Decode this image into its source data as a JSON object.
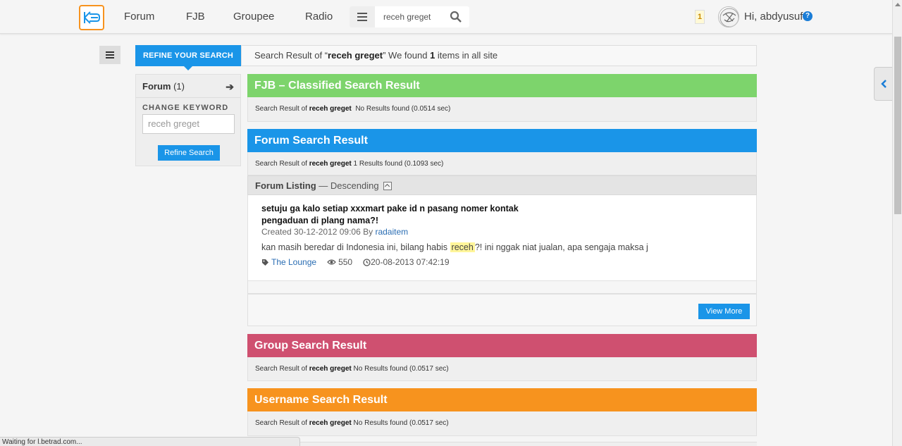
{
  "nav": {
    "links": [
      "Forum",
      "FJB",
      "Groupee",
      "Radio"
    ],
    "search_value": "receh greget",
    "notif_count": "1",
    "greeting": "Hi, abdyusuf",
    "help": "?"
  },
  "refine": {
    "tab_label": "REFINE YOUR SEARCH",
    "summary_prefix": "Search Result of “",
    "summary_query": "receh greget",
    "summary_mid": "” We found ",
    "summary_count": "1",
    "summary_suffix": " items in all site"
  },
  "sidebar": {
    "forum_label": "Forum",
    "forum_count": "(1)",
    "arrow": "➔",
    "change_keyword": "CHANGE KEYWORD",
    "keyword_placeholder": "receh greget",
    "refine_button": "Refine Search"
  },
  "sections": {
    "fjb": {
      "title": "FJB – Classified Search Result",
      "color": "#7dd46c",
      "prefix": "Search Result of ",
      "query": "receh greget",
      "status": "No Results found (0.0514 sec)"
    },
    "forum": {
      "title": "Forum Search Result",
      "color": "#1a95e8",
      "prefix": "Search Result of ",
      "query": "receh greget",
      "status": "1 Results found (0.1093 sec)"
    },
    "group": {
      "title": "Group Search Result",
      "color": "#cf5070",
      "prefix": "Search Result of ",
      "query": "receh greget",
      "status": "No Results found (0.0517 sec)"
    },
    "username": {
      "title": "Username Search Result",
      "color": "#f7931e",
      "prefix": "Search Result of ",
      "query": "receh greget",
      "status": "No Results found (0.0517 sec)"
    }
  },
  "listing": {
    "label": "Forum Listing",
    "order": " — Descending"
  },
  "thread": {
    "title_line1": "setuju ga kalo setiap xxxmart pake id n pasang nomer kontak",
    "title_line2": "pengaduan di plang nama?!",
    "created_prefix": "Created 30-12-2012 09:06 By ",
    "author": "radaitem",
    "snippet_before": "kan masih beredar di Indonesia ini, bilang habis ",
    "snippet_highlight": "receh",
    "snippet_after": "?! ini nggak niat jualan, apa sengaja maksa j",
    "category": "The Lounge",
    "views": "550",
    "last_post": "20-08-2013 07:42:19"
  },
  "view_more": "View More",
  "statusbar": "Waiting for l.betrad.com..."
}
